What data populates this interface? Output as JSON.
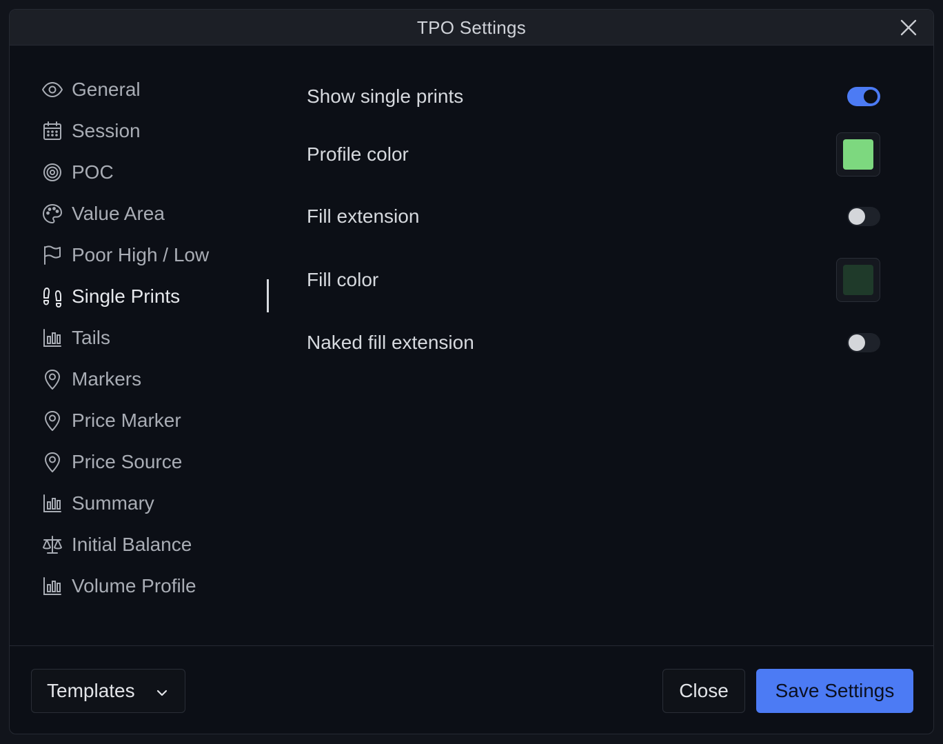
{
  "dialog": {
    "title": "TPO Settings"
  },
  "sidebar": {
    "items": [
      {
        "label": "General",
        "icon": "eye-icon",
        "active": false
      },
      {
        "label": "Session",
        "icon": "calendar-icon",
        "active": false
      },
      {
        "label": "POC",
        "icon": "target-icon",
        "active": false
      },
      {
        "label": "Value Area",
        "icon": "palette-icon",
        "active": false
      },
      {
        "label": "Poor High / Low",
        "icon": "flag-icon",
        "active": false
      },
      {
        "label": "Single Prints",
        "icon": "footprints-icon",
        "active": true
      },
      {
        "label": "Tails",
        "icon": "bar-chart-icon",
        "active": false
      },
      {
        "label": "Markers",
        "icon": "map-pin-icon",
        "active": false
      },
      {
        "label": "Price Marker",
        "icon": "map-pin-icon",
        "active": false
      },
      {
        "label": "Price Source",
        "icon": "map-pin-icon",
        "active": false
      },
      {
        "label": "Summary",
        "icon": "bar-chart-icon",
        "active": false
      },
      {
        "label": "Initial Balance",
        "icon": "scale-icon",
        "active": false
      },
      {
        "label": "Volume Profile",
        "icon": "bar-chart-icon",
        "active": false
      }
    ]
  },
  "settings": {
    "show_single_prints": {
      "label": "Show single prints",
      "enabled": true
    },
    "profile_color": {
      "label": "Profile color",
      "color": "#7dd87f"
    },
    "fill_extension": {
      "label": "Fill extension",
      "enabled": false
    },
    "fill_color": {
      "label": "Fill color",
      "color": "#1f3a2a"
    },
    "naked_fill_extension": {
      "label": "Naked fill extension",
      "enabled": false
    }
  },
  "footer": {
    "templates_label": "Templates",
    "close_label": "Close",
    "save_label": "Save Settings"
  },
  "colors": {
    "accent": "#4c7bf4",
    "background": "#0c0f16",
    "titlebar": "#1c1f26"
  }
}
